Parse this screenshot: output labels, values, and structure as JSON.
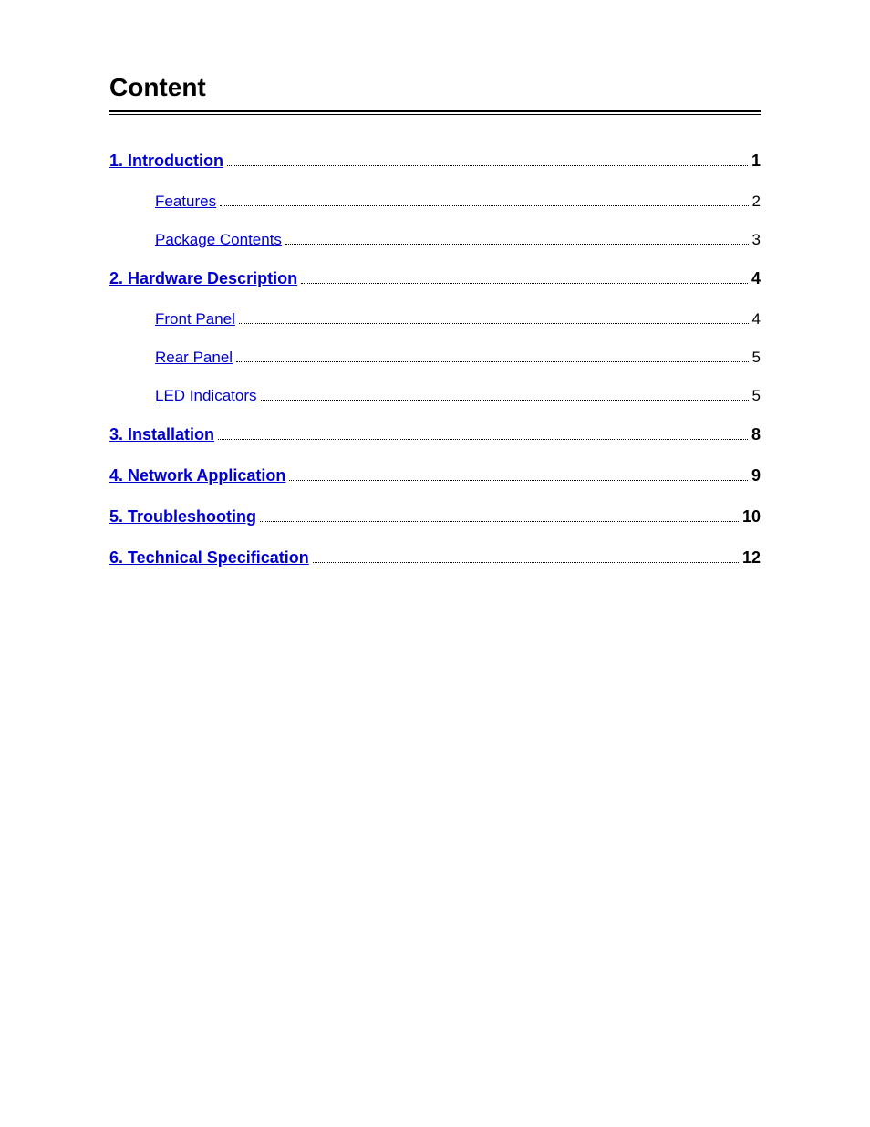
{
  "page": {
    "title": "Content",
    "toc": [
      {
        "label": "1. Introduction",
        "page": "1",
        "bold": true,
        "sub": false,
        "id": "introduction"
      },
      {
        "label": "Features",
        "page": "2",
        "bold": false,
        "sub": true,
        "id": "features"
      },
      {
        "label": "Package Contents",
        "page": "3",
        "bold": false,
        "sub": true,
        "id": "package-contents"
      },
      {
        "label": "2. Hardware Description",
        "page": "4",
        "bold": true,
        "sub": false,
        "id": "hardware-description"
      },
      {
        "label": "Front Panel",
        "page": "4",
        "bold": false,
        "sub": true,
        "id": "front-panel"
      },
      {
        "label": "Rear Panel",
        "page": "5",
        "bold": false,
        "sub": true,
        "id": "rear-panel"
      },
      {
        "label": "LED Indicators",
        "page": "5",
        "bold": false,
        "sub": true,
        "id": "led-indicators"
      },
      {
        "label": "3. Installation",
        "page": "8",
        "bold": true,
        "sub": false,
        "id": "installation"
      },
      {
        "label": "4. Network Application",
        "page": "9",
        "bold": true,
        "sub": false,
        "id": "network-application"
      },
      {
        "label": "5. Troubleshooting",
        "page": "10",
        "bold": true,
        "sub": false,
        "id": "troubleshooting"
      },
      {
        "label": "6. Technical Specification",
        "page": "12",
        "bold": true,
        "sub": false,
        "id": "technical-specification"
      }
    ]
  }
}
